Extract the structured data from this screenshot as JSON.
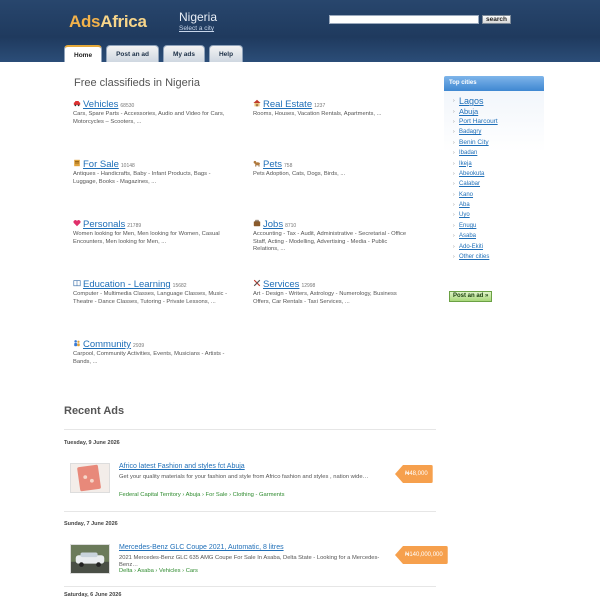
{
  "header": {
    "logo_ads": "Ads",
    "logo_africa": "Africa",
    "location": "Nigeria",
    "select_city": "Select a city",
    "search_placeholder": "",
    "search_button": "search"
  },
  "nav": [
    {
      "label": "Home",
      "active": true
    },
    {
      "label": "Post an ad",
      "active": false
    },
    {
      "label": "My ads",
      "active": false
    },
    {
      "label": "Help",
      "active": false
    }
  ],
  "main": {
    "title": "Free classifieds in Nigeria",
    "categories": [
      {
        "name": "Vehicles",
        "count": "68530",
        "icon": "car-icon",
        "desc": "Cars, Spare Parts - Accessories, Audio and Video for Cars, Motorcycles – Scooters, ..."
      },
      {
        "name": "Real Estate",
        "count": "1237",
        "icon": "house-icon",
        "desc": "Rooms, Houses, Vacation Rentals, Apartments, ..."
      },
      {
        "name": "For Sale",
        "count": "10148",
        "icon": "tag-icon",
        "desc": "Antiques - Handicrafts, Baby - Infant Products, Bags - Luggage, Books - Magazines, ..."
      },
      {
        "name": "Pets",
        "count": "758",
        "icon": "dog-icon",
        "desc": "Pets Adoption, Cats, Dogs, Birds, ..."
      },
      {
        "name": "Personals",
        "count": "21789",
        "icon": "heart-icon",
        "desc": "Women looking for Men, Men looking for Women, Casual Encounters, Men looking for Men, ..."
      },
      {
        "name": "Jobs",
        "count": "8710",
        "icon": "briefcase-icon",
        "desc": "Accounting - Tax - Audit, Administrative - Secretarial - Office Staff, Acting - Modelling, Advertising - Media - Public Relations, ..."
      },
      {
        "name": "Education - Learning",
        "count": "15682",
        "icon": "book-icon",
        "desc": "Computer - Multimedia Classes, Language Classes, Music - Theatre - Dance Classes, Tutoring - Private Lessons, ..."
      },
      {
        "name": "Services",
        "count": "12998",
        "icon": "tools-icon",
        "desc": "Art - Design - Writers, Astrology - Numerology, Business Offers, Car Rentals - Taxi Services, ..."
      },
      {
        "name": "Community",
        "count": "2939",
        "icon": "people-icon",
        "desc": "Carpool, Community Activities, Events, Musicians - Artists - Bands, ..."
      }
    ],
    "recent_title": "Recent Ads",
    "days": [
      {
        "date": "Tuesday, 9 June 2026",
        "ads": [
          {
            "title": "Africo latest Fashion and styles fct Abuja",
            "desc": "Get your quality materials for your fashion and style from Africo fashion and styles , nation wide…",
            "location": "Federal Capital Territory › Abuja › For Sale › Clothing - Garments",
            "price": "₦48,000"
          }
        ]
      },
      {
        "date": "Sunday, 7 June 2026",
        "ads": [
          {
            "title": "Mercedes-Benz GLC Coupe 2021, Automatic, 8 litres",
            "desc": "2021 Mercedes-Benz GLC 635 AMG Coupe For Sale In Asaba, Delta State - Looking for a Mercedes-Benz…",
            "location": "Delta › Asaba › Vehicles › Cars",
            "price": "₦140,000,000"
          }
        ]
      },
      {
        "date": "Saturday, 6 June 2026",
        "ads": []
      }
    ]
  },
  "sidebar": {
    "title": "Top cities",
    "cities": [
      "Lagos",
      "Abuja",
      "Port Harcourt",
      "Badagry",
      "Benin City",
      "Ibadan",
      "Ikeja",
      "Abeokuta",
      "Calabar",
      "Kano",
      "Aba",
      "Uyo",
      "Enugu",
      "Asaba",
      "Ado-Ekiti",
      "Other cities"
    ],
    "post_button": "Post an ad »"
  },
  "colors": {
    "header_bg": "#1f3a5e",
    "link": "#1f6fb8",
    "price_badge": "#f6a04d",
    "location_text": "#2e8b2e",
    "sidebar_head": "#3f87d1"
  }
}
